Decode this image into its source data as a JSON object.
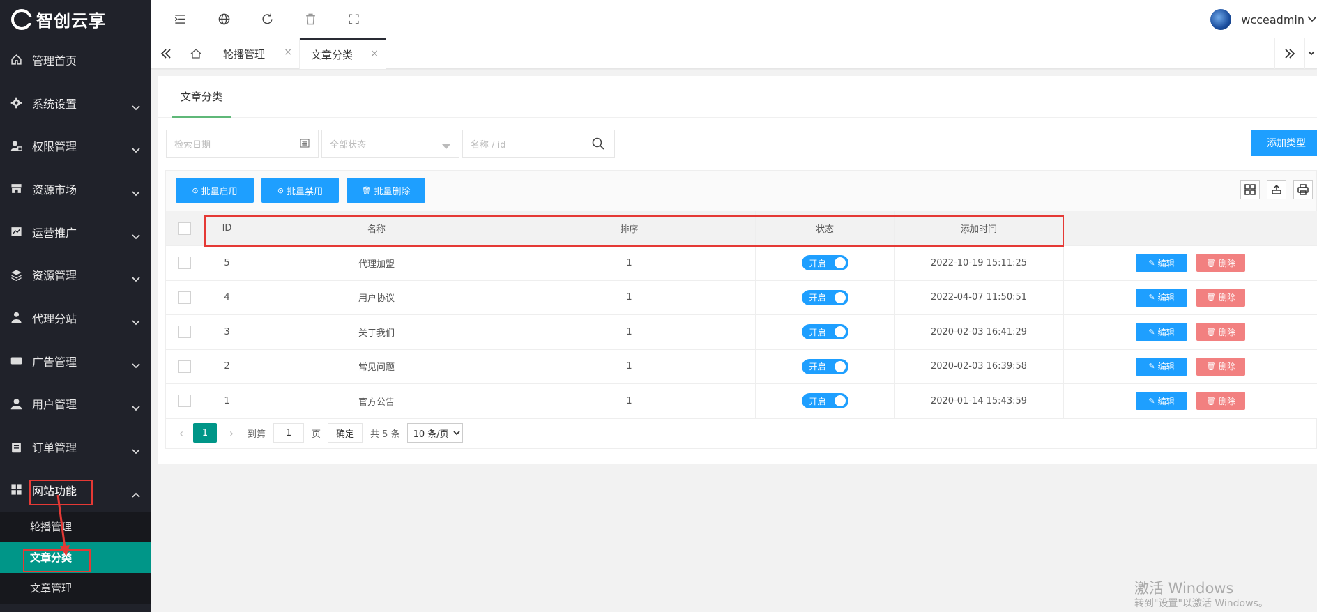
{
  "app": {
    "logo_text": "智创云享"
  },
  "sidebar": {
    "items": [
      {
        "label": "管理首页",
        "icon": "home-icon"
      },
      {
        "label": "系统设置",
        "icon": "gear-icon"
      },
      {
        "label": "权限管理",
        "icon": "user-lock-icon"
      },
      {
        "label": "资源市场",
        "icon": "store-icon"
      },
      {
        "label": "运营推广",
        "icon": "chart-icon"
      },
      {
        "label": "资源管理",
        "icon": "layers-icon"
      },
      {
        "label": "代理分站",
        "icon": "agent-icon"
      },
      {
        "label": "广告管理",
        "icon": "ad-icon"
      },
      {
        "label": "用户管理",
        "icon": "user-icon"
      },
      {
        "label": "订单管理",
        "icon": "order-icon"
      },
      {
        "label": "网站功能",
        "icon": "grid-icon"
      }
    ],
    "submenu": [
      {
        "label": "轮播管理"
      },
      {
        "label": "文章分类"
      },
      {
        "label": "文章管理"
      }
    ]
  },
  "header": {
    "username": "wcceadmin"
  },
  "tabs": [
    {
      "label": "轮播管理",
      "close": "×"
    },
    {
      "label": "文章分类",
      "close": "×"
    }
  ],
  "page": {
    "card_tab": "文章分类",
    "filters": {
      "date_placeholder": "检索日期",
      "status_placeholder": "全部状态",
      "search_placeholder": "名称 / id"
    },
    "add_button": "添加类型",
    "toolbar": {
      "enable_label": "批量启用",
      "disable_label": "批量禁用",
      "delete_label": "批量删除"
    }
  },
  "table": {
    "columns": [
      "ID",
      "名称",
      "排序",
      "状态",
      "添加时间"
    ],
    "rows": [
      {
        "id": "5",
        "name": "代理加盟",
        "sort": "1",
        "status": "开启",
        "time": "2022-10-19 15:11:25"
      },
      {
        "id": "4",
        "name": "用户协议",
        "sort": "1",
        "status": "开启",
        "time": "2022-04-07 11:50:51"
      },
      {
        "id": "3",
        "name": "关于我们",
        "sort": "1",
        "status": "开启",
        "time": "2020-02-03 16:41:29"
      },
      {
        "id": "2",
        "name": "常见问题",
        "sort": "1",
        "status": "开启",
        "time": "2020-02-03 16:39:58"
      },
      {
        "id": "1",
        "name": "官方公告",
        "sort": "1",
        "status": "开启",
        "time": "2020-01-14 15:43:59"
      }
    ],
    "edit_label": "编辑",
    "delete_label": "删除"
  },
  "pager": {
    "current": "1",
    "goto_label": "到第",
    "goto_value": "1",
    "page_label": "页",
    "confirm": "确定",
    "total": "共 5 条",
    "per_page": "10 条/页"
  },
  "watermark": {
    "title": "激活 Windows",
    "sub": "转到\"设置\"以激活 Windows。"
  },
  "colors": {
    "sidebar_bg": "#20222a",
    "active_green": "#009688",
    "primary_blue": "#1e9fff",
    "danger": "#f06b6b",
    "annotation_red": "#e53935"
  }
}
